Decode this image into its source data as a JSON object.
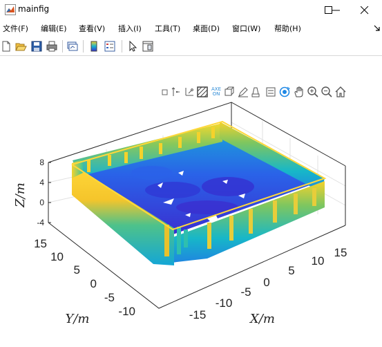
{
  "window": {
    "title": "mainfig",
    "controls": [
      "minimize",
      "maximize",
      "close"
    ]
  },
  "menubar": {
    "items": [
      {
        "label": "文件(F)"
      },
      {
        "label": "编辑(E)"
      },
      {
        "label": "查看(V)"
      },
      {
        "label": "插入(I)"
      },
      {
        "label": "工具(T)"
      },
      {
        "label": "桌面(D)"
      },
      {
        "label": "窗口(W)"
      },
      {
        "label": "帮助(H)"
      }
    ],
    "overflow_icon": "dock-arrow-icon"
  },
  "toolbar": {
    "icons": [
      "new-figure-icon",
      "open-file-icon",
      "save-icon",
      "print-icon",
      "link-plot-icon",
      "insert-colorbar-icon",
      "insert-legend-icon",
      "edit-plot-icon",
      "property-inspector-icon"
    ]
  },
  "axes_toolbar": {
    "icons": [
      "export-icon",
      "data-tips-icon",
      "brush-icon",
      "axes-box-icon",
      "axe-on-icon",
      "rotate-icon",
      "pan-icon",
      "zoom-in-icon",
      "zoom-out-icon",
      "home-icon"
    ],
    "axe_on_text": [
      "AXE",
      "ON"
    ]
  },
  "chart_data": {
    "type": "scatter3d",
    "description_of_surface": "point cloud of a rectangular basin with raised walls",
    "xlabel": "X/m",
    "ylabel": "Y/m",
    "zlabel": "Z/m",
    "x_ticks": [
      "-15",
      "-10",
      "-5",
      "0",
      "5",
      "10",
      "15"
    ],
    "y_ticks": [
      "15",
      "10",
      "5",
      "0",
      "-5",
      "-10"
    ],
    "z_ticks": [
      "8",
      "4",
      "0",
      "-4"
    ],
    "xlim": [
      -17,
      17
    ],
    "ylim": [
      -13,
      17
    ],
    "zlim": [
      -4,
      8
    ],
    "colormap": "parula",
    "grid": true,
    "colors": {
      "low": "#3a2fd0",
      "mid": "#16b3cf",
      "high": "#f5d22b",
      "top": "#ffd23b"
    }
  }
}
